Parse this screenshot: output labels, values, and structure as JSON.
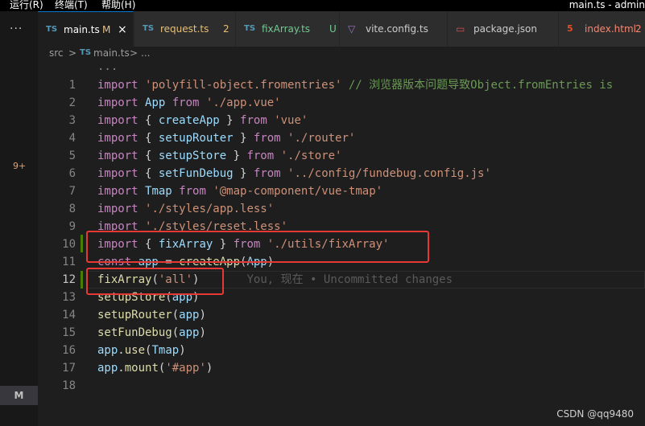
{
  "menubar": {
    "items": [
      "运行(R)",
      "终端(T)",
      "帮助(H)"
    ],
    "window_title": "main.ts - admin"
  },
  "activity": {
    "more_label": "···",
    "changes_badge": "9+",
    "scm_badge": "M"
  },
  "tabs": [
    {
      "icon": "TS",
      "name": "main.ts",
      "status": "M",
      "close": "×",
      "active": true,
      "name_color": "#ffffff",
      "status_color": "#e2c08d"
    },
    {
      "icon": "TS",
      "name": "request.ts",
      "status": "2",
      "close": "",
      "active": false,
      "name_color": "#e5c07b",
      "status_color": "#e5c07b"
    },
    {
      "icon": "TS",
      "name": "fixArray.ts",
      "status": "U",
      "close": "",
      "active": false,
      "name_color": "#73c991",
      "status_color": "#73c991"
    },
    {
      "icon": "▽",
      "name": "vite.config.ts",
      "status": "",
      "close": "",
      "active": false,
      "name_color": "#cccccc",
      "status_color": "#cccccc"
    },
    {
      "icon": "▭",
      "name": "package.json",
      "status": "",
      "close": "",
      "active": false,
      "name_color": "#cccccc",
      "status_color": "#cccccc"
    },
    {
      "icon": "5",
      "name": "index.html",
      "status": "2",
      "close": "",
      "active": false,
      "name_color": "#f48771",
      "status_color": "#f48771"
    }
  ],
  "breadcrumb": {
    "folder": "src",
    "sep": ">",
    "file_icon": "TS",
    "file": "main.ts",
    "more": "..."
  },
  "editor": {
    "fold_hint": "...",
    "lines": [
      {
        "n": "1",
        "tokens": [
          [
            "kw",
            "import "
          ],
          [
            "str",
            "'polyfill-object.fromentries'"
          ],
          [
            "cmt",
            " // 浏览器版本问题导致Object.fromEntries is"
          ]
        ]
      },
      {
        "n": "2",
        "tokens": [
          [
            "kw",
            "import "
          ],
          [
            "var",
            "App "
          ],
          [
            "kw",
            "from "
          ],
          [
            "str",
            "'./app.vue'"
          ]
        ]
      },
      {
        "n": "3",
        "tokens": [
          [
            "kw",
            "import "
          ],
          [
            "plain",
            "{ "
          ],
          [
            "var",
            "createApp "
          ],
          [
            "plain",
            "} "
          ],
          [
            "kw",
            "from "
          ],
          [
            "str",
            "'vue'"
          ]
        ]
      },
      {
        "n": "4",
        "tokens": [
          [
            "kw",
            "import "
          ],
          [
            "plain",
            "{ "
          ],
          [
            "var",
            "setupRouter "
          ],
          [
            "plain",
            "} "
          ],
          [
            "kw",
            "from "
          ],
          [
            "str",
            "'./router'"
          ]
        ]
      },
      {
        "n": "5",
        "tokens": [
          [
            "kw",
            "import "
          ],
          [
            "plain",
            "{ "
          ],
          [
            "var",
            "setupStore "
          ],
          [
            "plain",
            "} "
          ],
          [
            "kw",
            "from "
          ],
          [
            "str",
            "'./store'"
          ]
        ]
      },
      {
        "n": "6",
        "tokens": [
          [
            "kw",
            "import "
          ],
          [
            "plain",
            "{ "
          ],
          [
            "var",
            "setFunDebug "
          ],
          [
            "plain",
            "} "
          ],
          [
            "kw",
            "from "
          ],
          [
            "str",
            "'../config/fundebug.config.js'"
          ]
        ]
      },
      {
        "n": "7",
        "tokens": [
          [
            "kw",
            "import "
          ],
          [
            "var",
            "Tmap "
          ],
          [
            "kw",
            "from "
          ],
          [
            "str",
            "'@map-component/vue-tmap'"
          ]
        ]
      },
      {
        "n": "8",
        "tokens": [
          [
            "kw",
            "import "
          ],
          [
            "str",
            "'./styles/app.less'"
          ]
        ]
      },
      {
        "n": "9",
        "tokens": [
          [
            "kw",
            "import "
          ],
          [
            "str",
            "'./styles/reset.less'"
          ]
        ]
      },
      {
        "n": "10",
        "tokens": [
          [
            "kw",
            "import "
          ],
          [
            "plain",
            "{ "
          ],
          [
            "var",
            "fixArray "
          ],
          [
            "plain",
            "} "
          ],
          [
            "kw",
            "from "
          ],
          [
            "str",
            "'./utils/fixArray'"
          ]
        ]
      },
      {
        "n": "11",
        "tokens": [
          [
            "kw",
            "const "
          ],
          [
            "var",
            "app "
          ],
          [
            "plain",
            "= "
          ],
          [
            "fn",
            "createApp"
          ],
          [
            "plain",
            "("
          ],
          [
            "var",
            "App"
          ],
          [
            "plain",
            ")"
          ]
        ]
      },
      {
        "n": "12",
        "tokens": [
          [
            "fn",
            "fixArray"
          ],
          [
            "plain",
            "("
          ],
          [
            "str",
            "'all'"
          ],
          [
            "plain",
            ")"
          ],
          [
            "blame",
            "       You, 现在 • Uncommitted changes"
          ]
        ]
      },
      {
        "n": "13",
        "tokens": [
          [
            "fn",
            "setupStore"
          ],
          [
            "plain",
            "("
          ],
          [
            "var",
            "app"
          ],
          [
            "plain",
            ")"
          ]
        ]
      },
      {
        "n": "14",
        "tokens": [
          [
            "fn",
            "setupRouter"
          ],
          [
            "plain",
            "("
          ],
          [
            "var",
            "app"
          ],
          [
            "plain",
            ")"
          ]
        ]
      },
      {
        "n": "15",
        "tokens": [
          [
            "fn",
            "setFunDebug"
          ],
          [
            "plain",
            "("
          ],
          [
            "var",
            "app"
          ],
          [
            "plain",
            ")"
          ]
        ]
      },
      {
        "n": "16",
        "tokens": [
          [
            "var",
            "app"
          ],
          [
            "plain",
            "."
          ],
          [
            "fn",
            "use"
          ],
          [
            "plain",
            "("
          ],
          [
            "var",
            "Tmap"
          ],
          [
            "plain",
            ")"
          ]
        ]
      },
      {
        "n": "17",
        "tokens": [
          [
            "var",
            "app"
          ],
          [
            "plain",
            "."
          ],
          [
            "fn",
            "mount"
          ],
          [
            "plain",
            "("
          ],
          [
            "str",
            "'#app'"
          ],
          [
            "plain",
            ")"
          ]
        ]
      },
      {
        "n": "18",
        "tokens": []
      }
    ]
  },
  "watermark": "CSDN @qq9480",
  "colors": {
    "accent": "#0078d4",
    "highlight_box": "#e53935",
    "added_gutter": "#487e02"
  }
}
